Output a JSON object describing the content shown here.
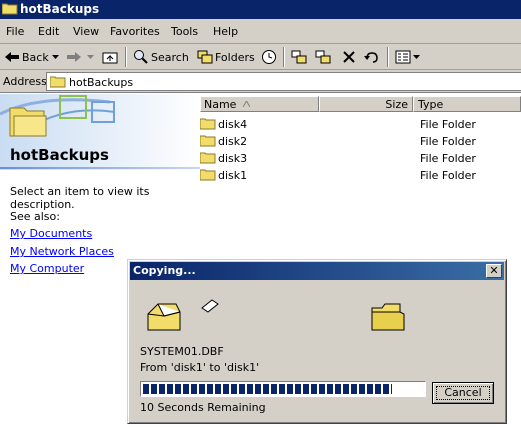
{
  "window": {
    "title": "hotBackups"
  },
  "menu": [
    {
      "label": "File"
    },
    {
      "label": "Edit"
    },
    {
      "label": "View"
    },
    {
      "label": "Favorites"
    },
    {
      "label": "Tools"
    },
    {
      "label": "Help"
    }
  ],
  "toolbar": {
    "back_label": "Back",
    "search_label": "Search",
    "folders_label": "Folders"
  },
  "address": {
    "label": "Address",
    "value": "hotBackups"
  },
  "left_pane": {
    "folder_title": "hotBackups",
    "description": "Select an item to view its description.",
    "see_also": "See also:",
    "links": [
      "My Documents",
      "My Network Places",
      "My Computer"
    ]
  },
  "file_list": {
    "columns": {
      "name": "Name",
      "size": "Size",
      "type": "Type"
    },
    "rows": [
      {
        "name": "disk4",
        "size": "",
        "type": "File Folder"
      },
      {
        "name": "disk2",
        "size": "",
        "type": "File Folder"
      },
      {
        "name": "disk3",
        "size": "",
        "type": "File Folder"
      },
      {
        "name": "disk1",
        "size": "",
        "type": "File Folder"
      }
    ]
  },
  "copy_dialog": {
    "title": "Copying...",
    "close_glyph": "✕",
    "file_name": "SYSTEM01.DBF",
    "from_to": "From 'disk1' to 'disk1'",
    "progress_fraction": 0.89,
    "time_remaining": "10 Seconds Remaining",
    "cancel_label": "Cancel"
  },
  "colors": {
    "titlebar": "#0a246a",
    "chrome": "#d4d0c8",
    "link": "#0000ff",
    "folder": "#f2dc6a"
  }
}
